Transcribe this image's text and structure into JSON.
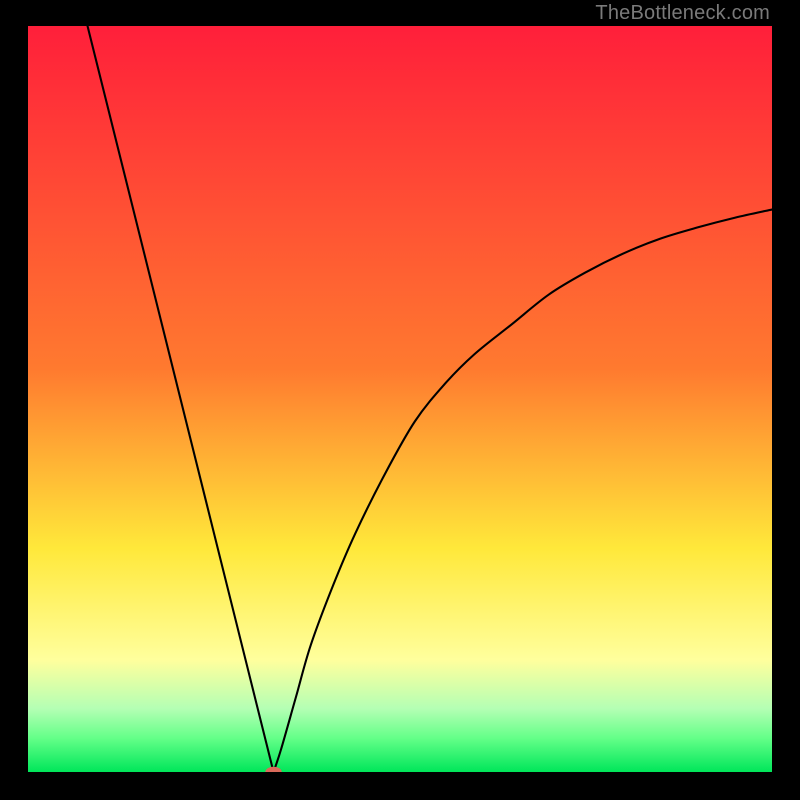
{
  "watermark": "TheBottleneck.com",
  "colors": {
    "red": "#ff1f3a",
    "orange_high": "#ff7a2f",
    "yellow": "#ffe83a",
    "pale_yellow": "#ffff9d",
    "pale_green": "#b4ffb4",
    "light_green": "#63ff88",
    "green": "#00e65a",
    "curve": "#000000",
    "marker": "#d96a5a",
    "frame": "#000000"
  },
  "chart_data": {
    "type": "line",
    "title": "",
    "xlabel": "",
    "ylabel": "",
    "xlim": [
      0,
      100
    ],
    "ylim": [
      0,
      100
    ],
    "grid": false,
    "legend": false,
    "description": "V-shaped bottleneck curve. Left branch is near-linear and steep; right branch is concave, rising and flattening toward the upper-right. Minimum sits at roughly x≈33 with value ≈0 (marked by a small dot).",
    "series": [
      {
        "name": "curve",
        "x": [
          8,
          12,
          16,
          20,
          24,
          28,
          30,
          32,
          33,
          34,
          36,
          38,
          41,
          44,
          48,
          52,
          56,
          60,
          65,
          70,
          75,
          80,
          85,
          90,
          95,
          100
        ],
        "y": [
          100,
          84,
          68,
          52,
          36,
          20,
          12,
          4,
          0,
          3,
          10,
          17,
          25,
          32,
          40,
          47,
          52,
          56,
          60,
          64,
          67,
          69.5,
          71.5,
          73,
          74.3,
          75.4
        ]
      }
    ],
    "marker": {
      "x": 33,
      "y": 0,
      "rx": 1.1,
      "ry": 0.7
    },
    "gradient_stops": [
      {
        "offset": 0.0,
        "key": "red"
      },
      {
        "offset": 0.46,
        "key": "orange_high"
      },
      {
        "offset": 0.7,
        "key": "yellow"
      },
      {
        "offset": 0.85,
        "key": "pale_yellow"
      },
      {
        "offset": 0.915,
        "key": "pale_green"
      },
      {
        "offset": 0.955,
        "key": "light_green"
      },
      {
        "offset": 1.0,
        "key": "green"
      }
    ]
  }
}
